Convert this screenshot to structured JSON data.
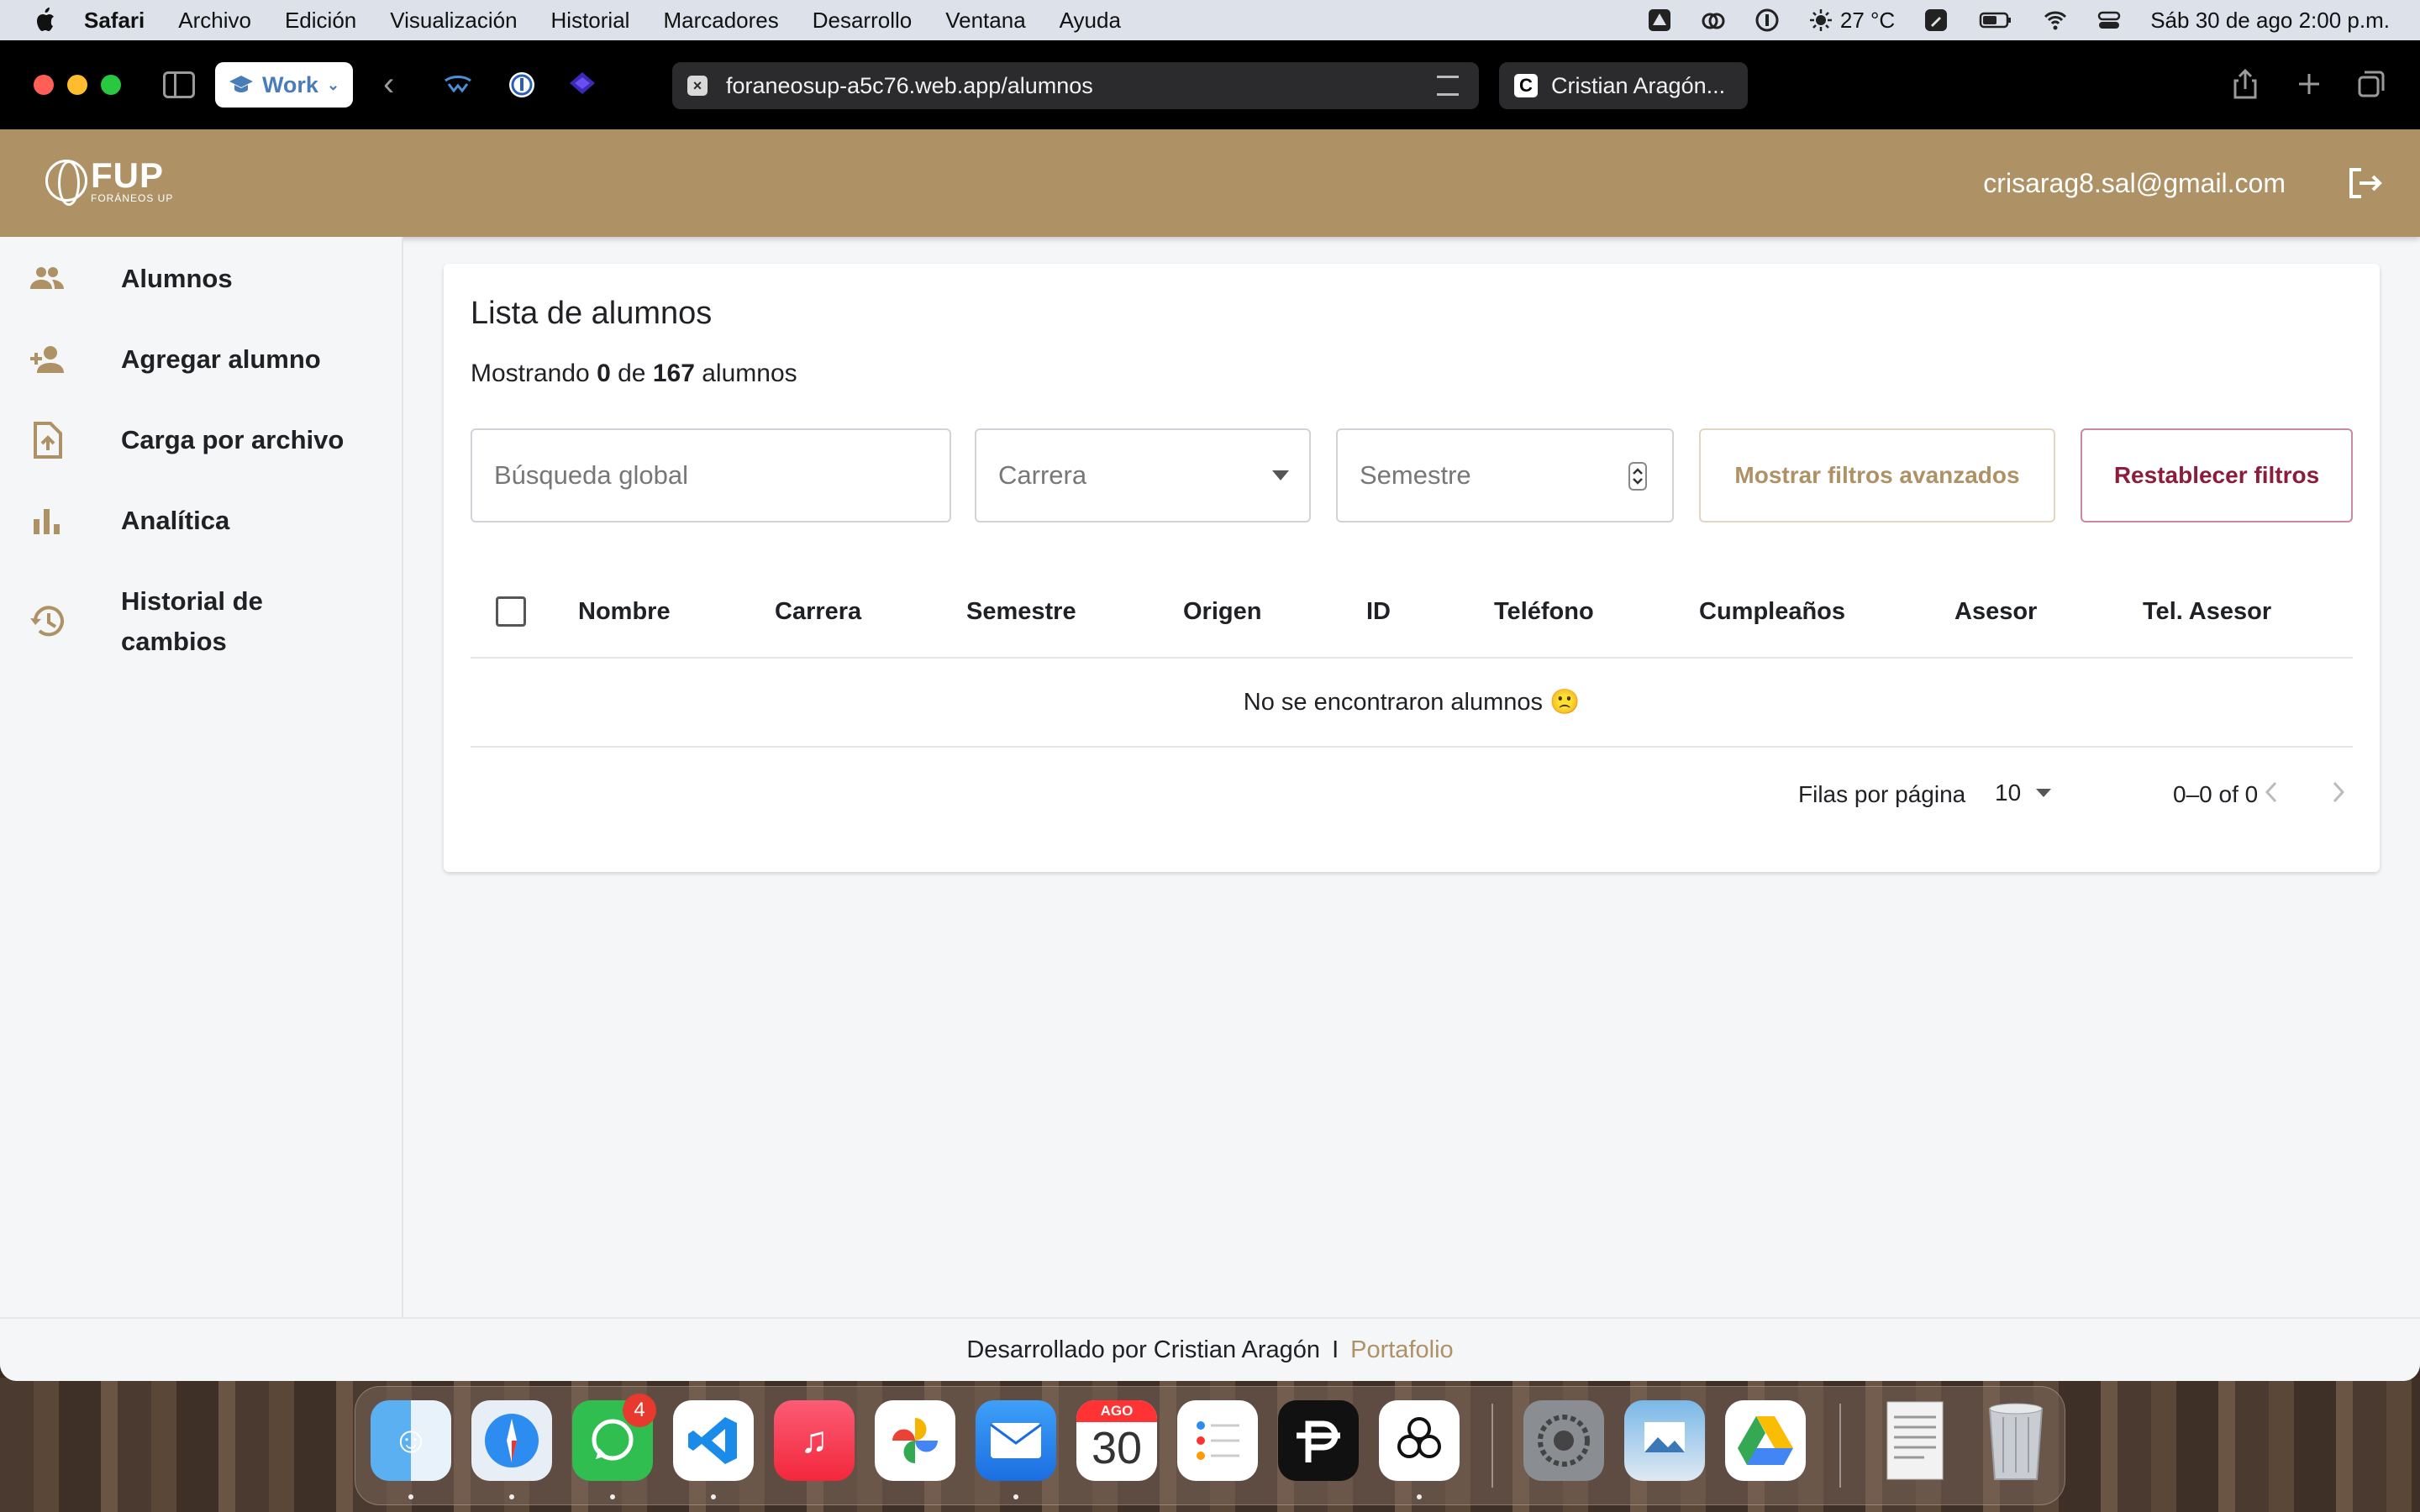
{
  "menubar": {
    "app": "Safari",
    "items": [
      "Archivo",
      "Edición",
      "Visualización",
      "Historial",
      "Marcadores",
      "Desarrollo",
      "Ventana",
      "Ayuda"
    ],
    "weather": "27 °C",
    "datetime": "Sáb 30 de ago  2:00 p.m."
  },
  "browser": {
    "profile": "Work",
    "url": "foraneosup-a5c76.web.app/alumnos",
    "other_tab": "Cristian Aragón..."
  },
  "header": {
    "logo_main": "FUP",
    "logo_sub": "FORÁNEOS UP",
    "email": "crisarag8.sal@gmail.com"
  },
  "sidebar": {
    "items": [
      {
        "label": "Alumnos",
        "icon": "people-icon"
      },
      {
        "label": "Agregar alumno",
        "icon": "person-add-icon"
      },
      {
        "label": "Carga por archivo",
        "icon": "file-upload-icon"
      },
      {
        "label": "Analítica",
        "icon": "bar-chart-icon"
      },
      {
        "label": "Historial de cambios",
        "icon": "history-icon"
      }
    ]
  },
  "main": {
    "title": "Lista de alumnos",
    "count_prefix": "Mostrando",
    "shown": "0",
    "count_mid": "de",
    "total": "167",
    "count_suffix": "alumnos",
    "search_placeholder": "Búsqueda global",
    "carrera_placeholder": "Carrera",
    "semestre_placeholder": "Semestre",
    "advanced_filters": "Mostrar filtros avanzados",
    "reset_filters": "Restablecer filtros",
    "columns": [
      "Nombre",
      "Carrera",
      "Semestre",
      "Origen",
      "ID",
      "Teléfono",
      "Cumpleaños",
      "Asesor",
      "Tel. Asesor"
    ],
    "empty_message": "No se encontraron alumnos 🙁",
    "rows_per_page_label": "Filas por página",
    "rows_per_page": "10",
    "range": "0–0 of 0"
  },
  "footer": {
    "text": "Desarrollado por Cristian Aragón",
    "separator": "I",
    "link": "Portafolio"
  },
  "dock": {
    "whatsapp_badge": "4",
    "calendar_month": "AGO",
    "calendar_day": "30"
  },
  "colors": {
    "brand": "#ae9265",
    "reset": "#8b1c3c",
    "menubar": "#dde1ea"
  }
}
